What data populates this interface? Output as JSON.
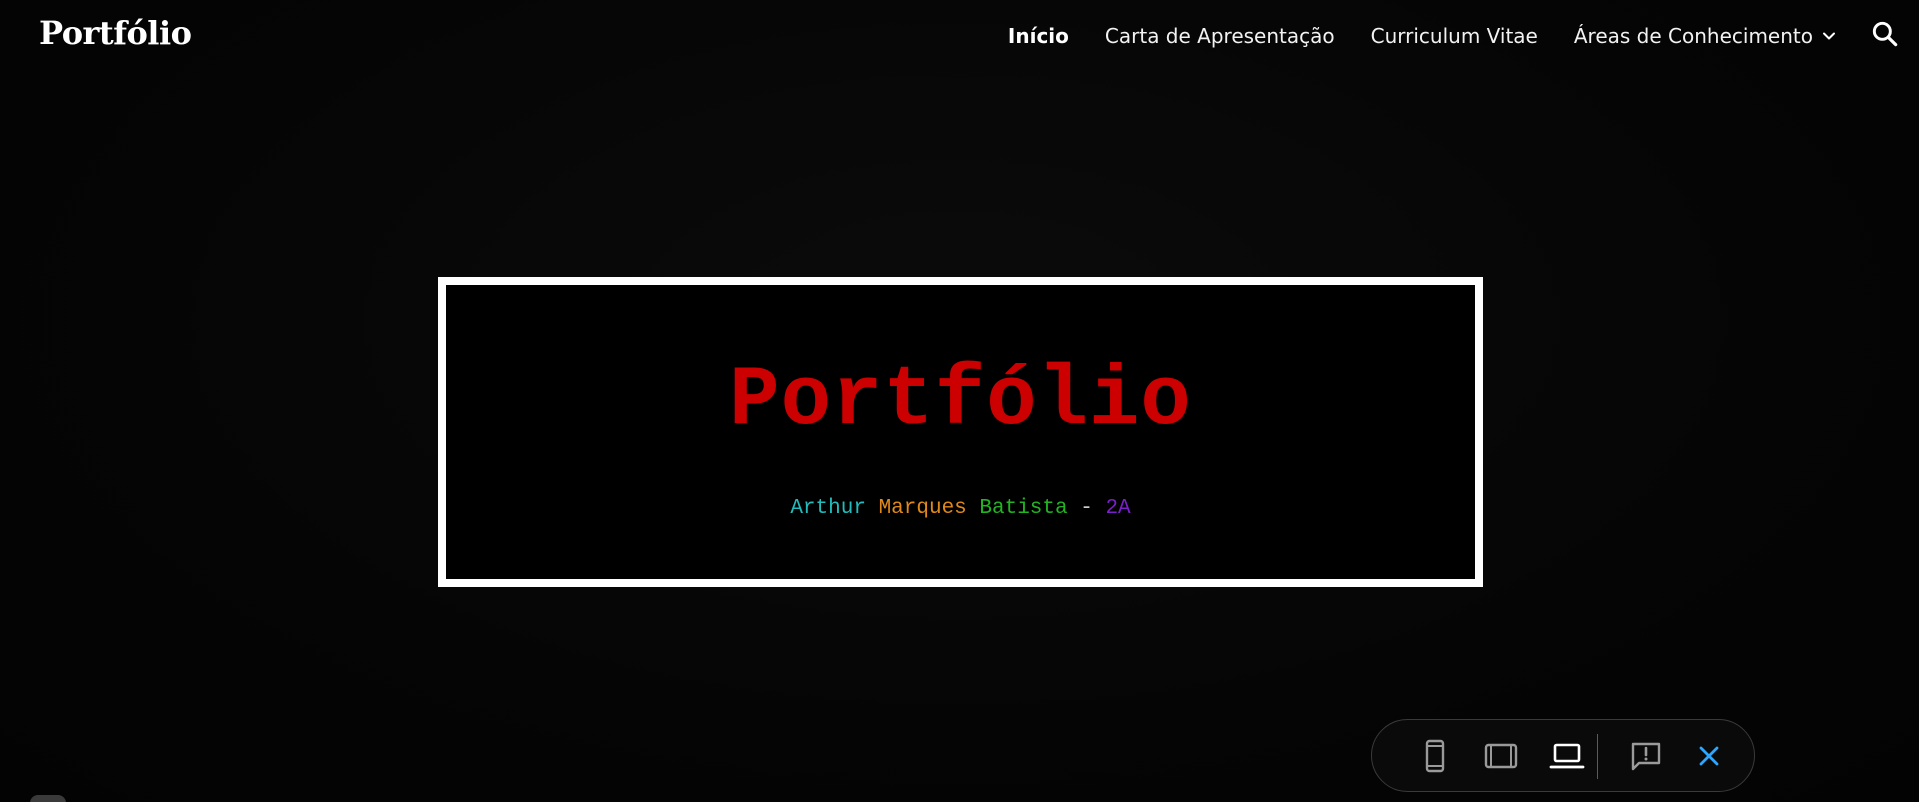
{
  "header": {
    "site_title": "Portfólio",
    "nav": [
      {
        "label": "Início",
        "active": true
      },
      {
        "label": "Carta de Apresentação",
        "active": false
      },
      {
        "label": "Curriculum Vitae",
        "active": false
      },
      {
        "label": "Áreas de Conhecimento",
        "active": false,
        "has_dropdown": true
      }
    ],
    "search_icon": "search-icon"
  },
  "hero": {
    "title": "Portfólio",
    "subtitle_parts": [
      {
        "text": "Arthur",
        "color": "#22bcbc"
      },
      {
        "text": "Marques",
        "color": "#e0891a"
      },
      {
        "text": "Batista",
        "color": "#22b422"
      },
      {
        "text": "-",
        "color": "#d0d0d0"
      },
      {
        "text": "2A",
        "color": "#7a1fc9"
      }
    ],
    "title_color": "#cc0000"
  },
  "toolbar": {
    "buttons": [
      {
        "icon": "phone-icon"
      },
      {
        "icon": "tablet-icon"
      },
      {
        "icon": "laptop-icon"
      },
      {
        "icon": "report-feedback-icon"
      },
      {
        "icon": "close-icon"
      }
    ]
  }
}
